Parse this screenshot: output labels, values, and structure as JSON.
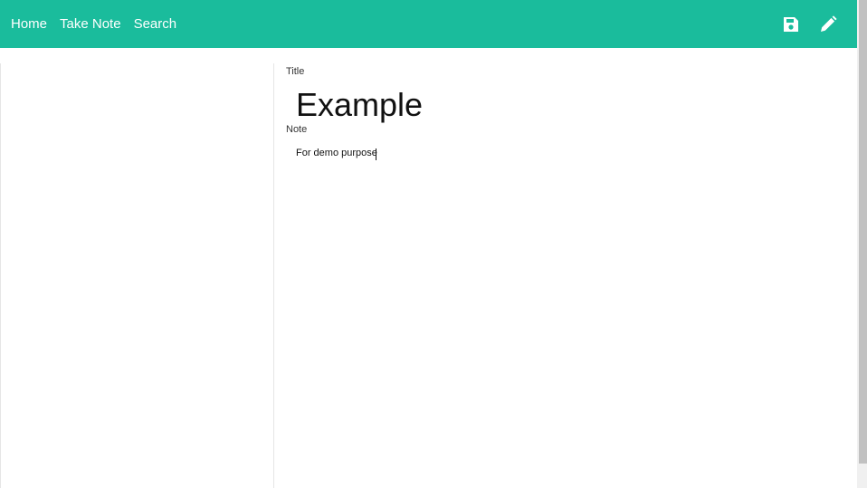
{
  "nav": {
    "links": [
      "Home",
      "Take Note",
      "Search"
    ],
    "actions": [
      {
        "icon": "save-icon",
        "label": "Save"
      },
      {
        "icon": "pencil-icon",
        "label": "Edit"
      }
    ]
  },
  "editor": {
    "title_label": "Title",
    "title_value": "Example",
    "note_label": "Note",
    "note_value": "For demo purpose"
  },
  "colors": {
    "navbar": "#1abc9c",
    "nav_text": "#ffffff"
  }
}
